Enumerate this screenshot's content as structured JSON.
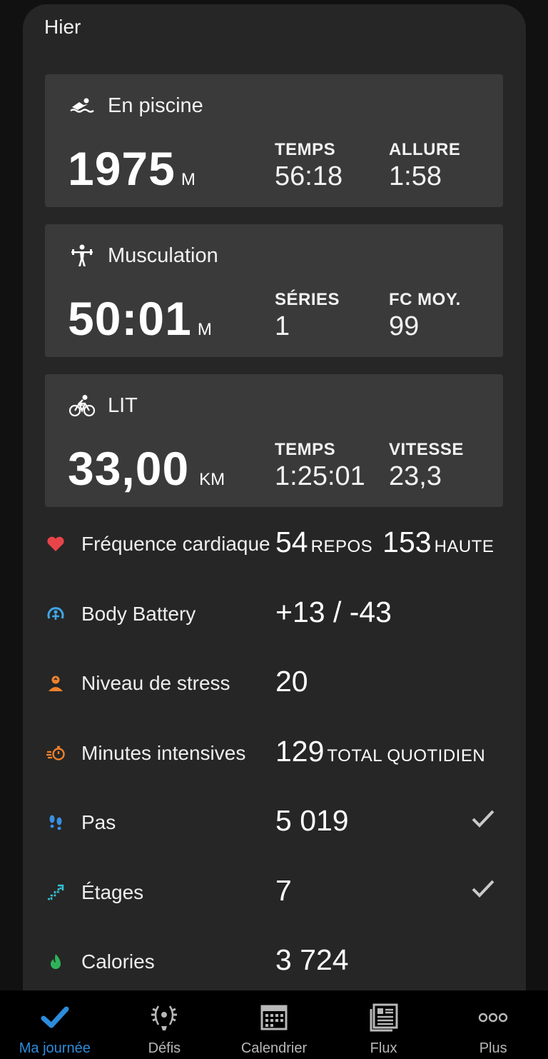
{
  "header": {
    "title": "Hier"
  },
  "activities": [
    {
      "icon": "swim-icon",
      "name": "En piscine",
      "value": "1975",
      "unit": "M",
      "stat1": {
        "label": "TEMPS",
        "value": "56:18"
      },
      "stat2": {
        "label": "ALLURE",
        "value": "1:58"
      }
    },
    {
      "icon": "strength-icon",
      "name": "Musculation",
      "value": "50:01",
      "unit": "M",
      "stat1": {
        "label": "SÉRIES",
        "value": "1"
      },
      "stat2": {
        "label": "FC MOY.",
        "value": "99"
      }
    },
    {
      "icon": "bike-icon",
      "name": "LIT",
      "value": "33,00",
      "unit": "KM",
      "stat1": {
        "label": "TEMPS",
        "value": "1:25:01"
      },
      "stat2": {
        "label": "VITESSE",
        "value": "23,3"
      }
    }
  ],
  "metrics": {
    "heart": {
      "label": "Fréquence cardiaque",
      "rest": "54",
      "rest_label": "REPOS",
      "high": "153",
      "high_label": "HAUTE"
    },
    "battery": {
      "label": "Body Battery",
      "value": "+13 / -43"
    },
    "stress": {
      "label": "Niveau de stress",
      "value": "20"
    },
    "intensity": {
      "label": "Minutes intensives",
      "value": "129",
      "sub": "TOTAL QUOTIDIEN"
    },
    "steps": {
      "label": "Pas",
      "value": "5 019"
    },
    "floors": {
      "label": "Étages",
      "value": "7"
    },
    "calories": {
      "label": "Calories",
      "value": "3 724"
    }
  },
  "tabs": [
    {
      "label": "Ma journée",
      "icon": "checkmark-icon",
      "active": true
    },
    {
      "label": "Défis",
      "icon": "laurel-icon",
      "active": false
    },
    {
      "label": "Calendrier",
      "icon": "calendar-icon",
      "active": false
    },
    {
      "label": "Flux",
      "icon": "newsfeed-icon",
      "active": false
    },
    {
      "label": "Plus",
      "icon": "more-icon",
      "active": false
    }
  ],
  "colors": {
    "accent": "#2c8cdc",
    "heart": "#e8444a",
    "battery": "#3ea6e6",
    "stress": "#f0822d",
    "steps": "#3a8fe0",
    "floors": "#35c2d6",
    "calories": "#2fb35a"
  }
}
